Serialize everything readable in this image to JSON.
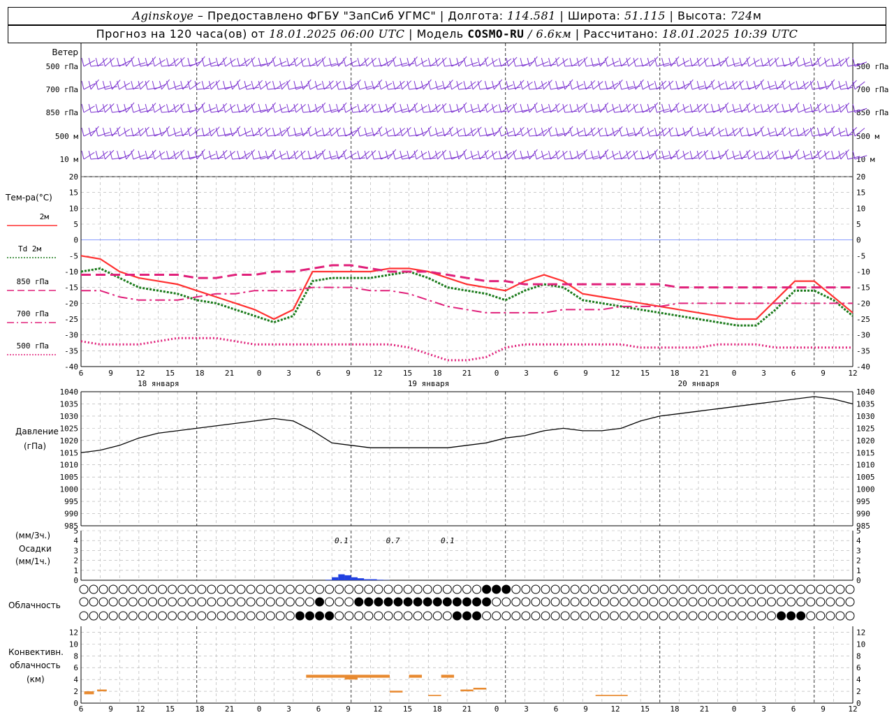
{
  "header": {
    "station": "Aginskoye",
    "provider": "– Предоставлено ФГБУ \"ЗапСиб УГМС\"",
    "lon_label": "Долгота:",
    "lon": "114.581",
    "lat_label": "Широта:",
    "lat": "51.115",
    "alt_label": "Высота:",
    "alt": "724",
    "alt_unit": "м",
    "forecast_label": "Прогноз на 120 часа(ов) от",
    "forecast_time": "18.01.2025 06:00 UTC",
    "model_label": "Модель",
    "model": "COSMO-RU",
    "model_res": "/ 6.6км",
    "calc_label": "Рассчитано:",
    "calc_time": "18.01.2025 10:39 UTC"
  },
  "wind_panel": {
    "title": "Ветер",
    "levels": [
      "500 гПа",
      "700 гПа",
      "850 гПа",
      "500 м",
      "10  м"
    ]
  },
  "temp_panel": {
    "title": "Тем-ра(°C)",
    "legend": [
      {
        "label": "2м",
        "color": "#ff3030",
        "style": "solid"
      },
      {
        "label": "Td  2м",
        "color": "#1a7a1a",
        "style": "dotted"
      },
      {
        "label": "850 гПа",
        "color": "#e0207a",
        "style": "dashed"
      },
      {
        "label": "700 гПа",
        "color": "#e0207a",
        "style": "dashdot"
      },
      {
        "label": "500 гПа",
        "color": "#e0207a",
        "style": "dotted"
      }
    ],
    "yticks": [
      20,
      15,
      10,
      5,
      0,
      -5,
      -10,
      -15,
      -20,
      -25,
      -30,
      -35,
      -40
    ]
  },
  "pressure_panel": {
    "title1": "Давление",
    "title2": "(гПа)",
    "yticks": [
      1040,
      1035,
      1030,
      1025,
      1020,
      1015,
      1010,
      1005,
      1000,
      995,
      990,
      985
    ]
  },
  "precip_panel": {
    "unit1": "(мм/3ч.)",
    "title": "Осадки",
    "unit2": "(мм/1ч.)",
    "yticks": [
      5,
      4,
      3,
      2,
      1,
      0
    ],
    "labels": [
      "0.1",
      "0.7",
      "0.1"
    ]
  },
  "cloud_panel": {
    "title": "Облачность"
  },
  "conv_panel": {
    "title1": "Конвективн.",
    "title2": "облачность",
    "title3": "(км)",
    "yticks": [
      12,
      10,
      8,
      6,
      4,
      2,
      0
    ]
  },
  "time_axis": {
    "hour_labels": [
      "6",
      "9",
      "12",
      "15",
      "18",
      "21",
      "0",
      "3",
      "6",
      "9",
      "12",
      "15",
      "18",
      "21",
      "0",
      "3",
      "6",
      "9",
      "12",
      "15",
      "18",
      "21",
      "0",
      "3",
      "6",
      "9",
      "12"
    ],
    "dates": [
      "18 января",
      "19 января",
      "20 января"
    ]
  },
  "colors": {
    "wind": "#7a30d0",
    "t2m": "#ff3030",
    "td2m": "#1a7a1a",
    "upper": "#e0207a",
    "pressure": "#000000",
    "precip": "#2040e0",
    "conv": "#e88a30",
    "zero_line": "#4060ff"
  },
  "chart_data": [
    {
      "type": "line",
      "title": "Тем-ра(°C)",
      "x_hours": [
        0,
        3,
        6,
        9,
        12,
        15,
        18,
        21,
        24,
        27,
        30,
        33,
        36,
        39,
        42,
        45,
        48,
        51,
        54,
        57,
        60,
        63,
        66,
        69,
        72,
        75,
        78,
        81,
        84,
        87,
        90,
        93,
        96,
        99,
        102,
        105,
        108,
        111,
        114,
        117,
        120
      ],
      "ylim": [
        -40,
        20
      ],
      "series": [
        {
          "name": "2м",
          "values": [
            -5,
            -6,
            -10,
            -12,
            -13,
            -14,
            -16,
            -18,
            -20,
            -22,
            -25,
            -22,
            -10,
            -10,
            -10,
            -10,
            -9,
            -9,
            -10,
            -12,
            -14,
            -15,
            -16,
            -13,
            -11,
            -13,
            -17,
            -18,
            -19,
            -20,
            -21,
            -22,
            -23,
            -24,
            -25,
            -25,
            -19,
            -13,
            -13,
            -18,
            -23
          ]
        },
        {
          "name": "Td  2м",
          "values": [
            -10,
            -9,
            -12,
            -15,
            -16,
            -17,
            -19,
            -20,
            -22,
            -24,
            -26,
            -24,
            -13,
            -12,
            -12,
            -12,
            -11,
            -10,
            -12,
            -15,
            -16,
            -17,
            -19,
            -16,
            -14,
            -15,
            -19,
            -20,
            -21,
            -22,
            -23,
            -24,
            -25,
            -26,
            -27,
            -27,
            -22,
            -16,
            -16,
            -19,
            -24
          ]
        },
        {
          "name": "850 гПа",
          "values": [
            -11,
            -11,
            -11,
            -11,
            -11,
            -11,
            -12,
            -12,
            -11,
            -11,
            -10,
            -10,
            -9,
            -8,
            -8,
            -9,
            -10,
            -10,
            -10,
            -11,
            -12,
            -13,
            -13,
            -14,
            -14,
            -14,
            -14,
            -14,
            -14,
            -14,
            -14,
            -15,
            -15,
            -15,
            -15,
            -15,
            -15,
            -15,
            -15,
            -15,
            -15
          ]
        },
        {
          "name": "700 гПа",
          "values": [
            -16,
            -16,
            -18,
            -19,
            -19,
            -19,
            -18,
            -17,
            -17,
            -16,
            -16,
            -16,
            -15,
            -15,
            -15,
            -16,
            -16,
            -17,
            -19,
            -21,
            -22,
            -23,
            -23,
            -23,
            -23,
            -22,
            -22,
            -22,
            -21,
            -21,
            -21,
            -20,
            -20,
            -20,
            -20,
            -20,
            -20,
            -20,
            -20,
            -20,
            -20
          ]
        },
        {
          "name": "500 гПа",
          "values": [
            -32,
            -33,
            -33,
            -33,
            -32,
            -31,
            -31,
            -31,
            -32,
            -33,
            -33,
            -33,
            -33,
            -33,
            -33,
            -33,
            -33,
            -34,
            -36,
            -38,
            -38,
            -37,
            -34,
            -33,
            -33,
            -33,
            -33,
            -33,
            -33,
            -34,
            -34,
            -34,
            -34,
            -33,
            -33,
            -33,
            -34,
            -34,
            -34,
            -34,
            -34
          ]
        }
      ]
    },
    {
      "type": "line",
      "title": "Давление",
      "ylim": [
        985,
        1040
      ],
      "series": [
        {
          "name": "Давление",
          "values": [
            1015,
            1016,
            1018,
            1021,
            1023,
            1024,
            1025,
            1026,
            1027,
            1028,
            1029,
            1028,
            1024,
            1019,
            1018,
            1017,
            1017,
            1017,
            1017,
            1017,
            1018,
            1019,
            1021,
            1022,
            1024,
            1025,
            1024,
            1024,
            1025,
            1028,
            1030,
            1031,
            1032,
            1033,
            1034,
            1035,
            1036,
            1037,
            1038,
            1037,
            1035
          ]
        }
      ]
    },
    {
      "type": "bar",
      "title": "Осадки",
      "ylim": [
        0,
        5
      ],
      "x_hours": [
        38,
        39,
        40,
        41,
        42,
        43,
        44,
        45,
        46,
        47
      ],
      "values": [
        0.05,
        0.3,
        0.6,
        0.5,
        0.3,
        0.2,
        0.1,
        0.1,
        0.05,
        0.02
      ]
    },
    {
      "type": "bar",
      "title": "Конвективн. облачность",
      "ylim": [
        0,
        13
      ],
      "segments": [
        {
          "x0": 0.5,
          "x1": 2,
          "base": 1.5,
          "top": 2
        },
        {
          "x0": 2.5,
          "x1": 4,
          "base": 2,
          "top": 2.3
        },
        {
          "x0": 35,
          "x1": 41,
          "base": 4.3,
          "top": 4.8
        },
        {
          "x0": 41,
          "x1": 43,
          "base": 4,
          "top": 4.8
        },
        {
          "x0": 43,
          "x1": 48,
          "base": 4.3,
          "top": 4.8
        },
        {
          "x0": 48,
          "x1": 50,
          "base": 1.8,
          "top": 2.1
        },
        {
          "x0": 51,
          "x1": 53,
          "base": 4.3,
          "top": 4.8
        },
        {
          "x0": 56,
          "x1": 58,
          "base": 4.3,
          "top": 4.8
        },
        {
          "x0": 54,
          "x1": 56,
          "base": 1.2,
          "top": 1.4
        },
        {
          "x0": 59,
          "x1": 61,
          "base": 2,
          "top": 2.3
        },
        {
          "x0": 61,
          "x1": 63,
          "base": 2.3,
          "top": 2.6
        },
        {
          "x0": 80,
          "x1": 85,
          "base": 1.2,
          "top": 1.4
        }
      ]
    }
  ]
}
